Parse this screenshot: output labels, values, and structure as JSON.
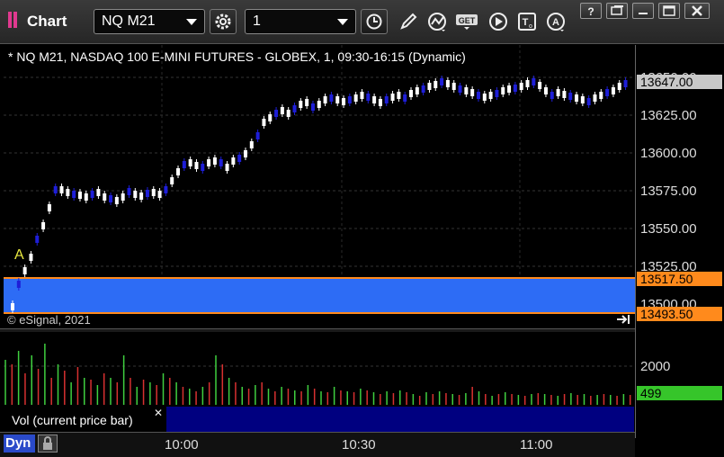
{
  "window": {
    "title": "Chart"
  },
  "toolbar": {
    "symbol": "NQ M21",
    "interval": "1",
    "icons": [
      "gear-icon",
      "clock-icon",
      "pencil-icon",
      "study-icon",
      "get-icon",
      "play-icon",
      "text-tool-icon",
      "alert-icon"
    ]
  },
  "chart": {
    "header": "* NQ M21, NASDAQ 100 E-MINI FUTURES - GLOBEX, 1, 09:30-16:15 (Dynamic)",
    "copyright": "© eSignal, 2021",
    "marker": "A",
    "price_tags": {
      "last": "13647.00",
      "zone_top": "13517.50",
      "zone_bottom": "13493.50"
    },
    "y_labels": [
      "13650.00",
      "13625.00",
      "13600.00",
      "13575.00",
      "13550.00",
      "13525.00",
      "13500.00"
    ],
    "x_labels": [
      "10:00",
      "10:30",
      "11:00"
    ],
    "colors": {
      "up": "#ffffff",
      "down": "#1e1ed8",
      "zone": "#2d6cf5",
      "zone_border": "#ff8a1c",
      "last_tag": "#c8c8c8"
    }
  },
  "volume": {
    "label": "Vol (current price bar)",
    "y_label": "2000",
    "current_tag": "499",
    "colors": {
      "up": "#3fcf3f",
      "down": "#d83030",
      "tag": "#36c52a"
    }
  },
  "status": {
    "mode": "Dyn"
  }
}
